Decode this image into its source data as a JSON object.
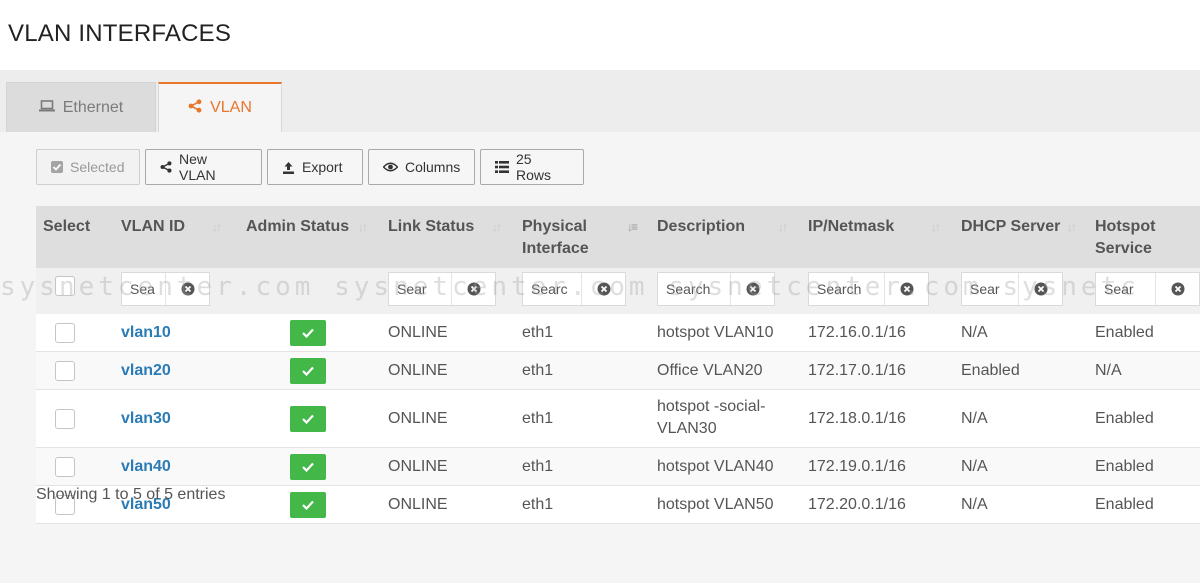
{
  "page": {
    "title": "VLAN INTERFACES"
  },
  "tabs": [
    {
      "label": "Ethernet",
      "icon": "laptop-icon",
      "active": false
    },
    {
      "label": "VLAN",
      "icon": "share-icon",
      "active": true
    }
  ],
  "toolbar": {
    "selected_label": "Selected",
    "new_vlan_label": "New VLAN",
    "export_label": "Export",
    "columns_label": "Columns",
    "rows_label": "25 Rows"
  },
  "table": {
    "columns": [
      {
        "line1": "Select",
        "line2": ""
      },
      {
        "line1": "VLAN ID",
        "line2": ""
      },
      {
        "line1": "Admin Status",
        "line2": ""
      },
      {
        "line1": "Link Status",
        "line2": ""
      },
      {
        "line1": "Physical",
        "line2": "Interface"
      },
      {
        "line1": "Description",
        "line2": ""
      },
      {
        "line1": "IP/Netmask",
        "line2": ""
      },
      {
        "line1": "DHCP Server",
        "line2": ""
      },
      {
        "line1": "Hotspot",
        "line2": "Service"
      }
    ],
    "filter_placeholders": {
      "vlan_id": "Sea",
      "link_status": "Sear",
      "physical_interface": "Searc",
      "description": "Search",
      "ip_netmask": "Search",
      "dhcp_server": "Sear",
      "hotspot": "Sear"
    },
    "rows": [
      {
        "vlan_id": "vlan10",
        "link_status": "ONLINE",
        "physical": "eth1",
        "description": "hotspot VLAN10",
        "ip": "172.16.0.1/16",
        "dhcp": "N/A",
        "hotspot": "Enabled"
      },
      {
        "vlan_id": "vlan20",
        "link_status": "ONLINE",
        "physical": "eth1",
        "description": "Office VLAN20",
        "ip": "172.17.0.1/16",
        "dhcp": "Enabled",
        "hotspot": "N/A"
      },
      {
        "vlan_id": "vlan30",
        "link_status": "ONLINE",
        "physical": "eth1",
        "description": "hotspot -social-",
        "description2": "VLAN30",
        "ip": "172.18.0.1/16",
        "dhcp": "N/A",
        "hotspot": "Enabled"
      },
      {
        "vlan_id": "vlan40",
        "link_status": "ONLINE",
        "physical": "eth1",
        "description": "hotspot VLAN40",
        "ip": "172.19.0.1/16",
        "dhcp": "N/A",
        "hotspot": "Enabled"
      },
      {
        "vlan_id": "vlan50",
        "link_status": "ONLINE",
        "physical": "eth1",
        "description": "hotspot VLAN50",
        "ip": "172.20.0.1/16",
        "dhcp": "N/A",
        "hotspot": "Enabled"
      }
    ]
  },
  "footer": {
    "info": "Showing 1 to 5 of 5 entries"
  },
  "watermark": {
    "text": "sysnetcenter.com sysnetcenter.com sysnetcenter.com sysnetc"
  },
  "colors": {
    "accent": "#e8762d",
    "link": "#2b7cb5",
    "status_ok": "#44b749"
  }
}
